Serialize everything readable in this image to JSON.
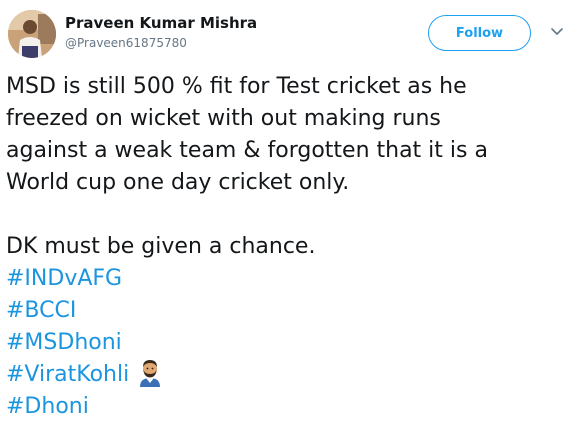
{
  "author": {
    "display_name": "Praveen Kumar Mishra",
    "handle": "@Praveen61875780",
    "avatar_icon": "user-avatar-photo"
  },
  "actions": {
    "follow_label": "Follow",
    "more_icon": "chevron-down-icon"
  },
  "tweet": {
    "lines": [
      "MSD is still 500 % fit for Test cricket as he",
      "freezed on wicket with out making runs",
      "against a weak team & forgotten that it is a",
      "World cup one day cricket only.",
      "",
      "DK must be given a chance."
    ],
    "hashtags": [
      "#INDvAFG",
      "#BCCI",
      "#MSDhoni",
      "#ViratKohli",
      "#Dhoni"
    ],
    "emoji_after_hashtag_index": 3,
    "emoji_icon": "bearded-man-emoji-icon"
  },
  "colors": {
    "accent": "#1da1f2",
    "hashtag": "#1b95e0",
    "text": "#14171a",
    "secondary_text": "#657786"
  }
}
